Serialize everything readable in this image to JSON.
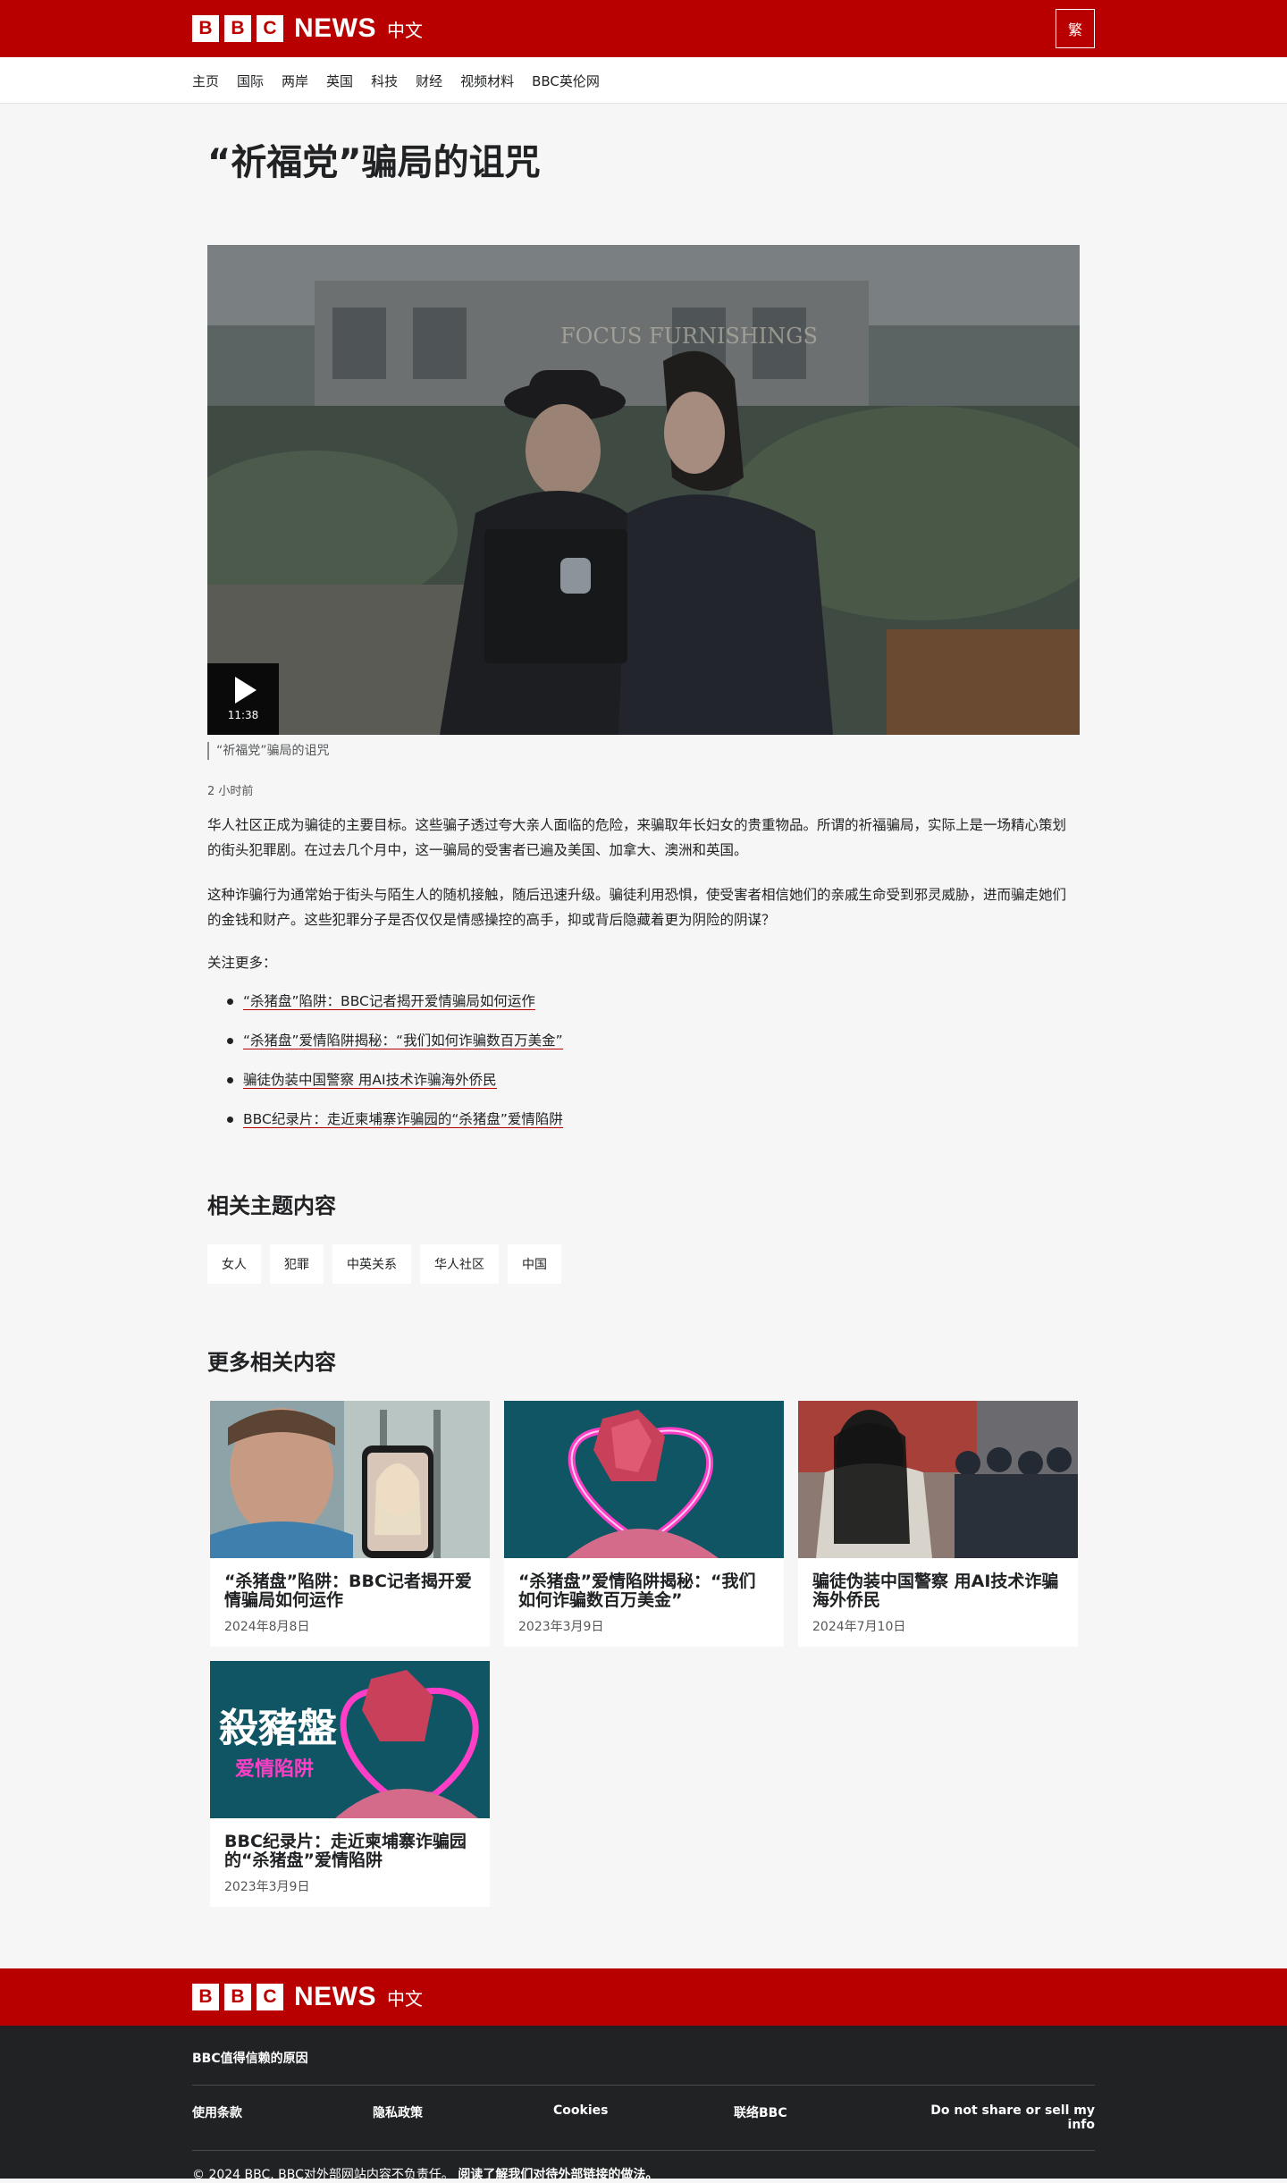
{
  "header": {
    "brand_letters": [
      "B",
      "B",
      "C"
    ],
    "brand_news": "NEWS",
    "brand_lang": "中文",
    "lang_toggle": "繁"
  },
  "nav": {
    "items": [
      "主页",
      "国际",
      "两岸",
      "英国",
      "科技",
      "财经",
      "视频材料",
      "BBC英伦网"
    ]
  },
  "article": {
    "title": "“祈福党”骗局的诅咒",
    "video": {
      "duration": "11:38",
      "caption": "“祈福党”骗局的诅咒",
      "scene_text": "FOCUS FURNISHINGS"
    },
    "timestamp": "2 小时前",
    "paragraphs": [
      "华人社区正成为骗徒的主要目标。这些骗子透过夸大亲人面临的危险，来骗取年长妇女的贵重物品。所谓的祈福骗局，实际上是一场精心策划的街头犯罪剧。在过去几个月中，这一骗局的受害者已遍及美国、加拿大、澳洲和英国。",
      "这种诈骗行为通常始于街头与陌生人的随机接触，随后迅速升级。骗徒利用恐惧，使受害者相信她们的亲戚生命受到邪灵威胁，进而骗走她们的金钱和财产。这些犯罪分子是否仅仅是情感操控的高手，抑或背后隐藏着更为阴险的阴谋？"
    ],
    "more_label": "关注更多：",
    "links": [
      "“杀猪盘”陷阱：BBC记者揭开爱情骗局如何运作",
      "“杀猪盘”爱情陷阱揭秘：“我们如何诈骗数百万美金”",
      "骗徒伪装中国警察 用AI技术诈骗海外侨民",
      "BBC纪录片：走近柬埔寨诈骗园的“杀猪盘”爱情陷阱"
    ]
  },
  "topics": {
    "title": "相关主题内容",
    "items": [
      "女人",
      "犯罪",
      "中英关系",
      "华人社区",
      "中国"
    ]
  },
  "related": {
    "title": "更多相关内容",
    "cards": [
      {
        "title": "“杀猪盘”陷阱：BBC记者揭开爱情骗局如何运作",
        "date": "2024年8月8日"
      },
      {
        "title": "“杀猪盘”爱情陷阱揭秘：“我们如何诈骗数百万美金”",
        "date": "2023年3月9日"
      },
      {
        "title": "骗徒伪装中国警察 用AI技术诈骗海外侨民",
        "date": "2024年7月10日"
      },
      {
        "title": "BBC纪录片：走近柬埔寨诈骗园的“杀猪盘”爱情陷阱",
        "date": "2023年3月9日",
        "thumb_text_1": "殺豬盤",
        "thumb_text_2": "爱情陷阱"
      }
    ]
  },
  "footer": {
    "trust": "BBC值得信赖的原因",
    "links": [
      "使用条款",
      "隐私政策",
      "Cookies",
      "联络BBC",
      "Do not share or sell my info"
    ],
    "copyright": "© 2024 BBC. BBC对外部网站内容不负责任。",
    "external_link": "阅读了解我们对待外部链接的做法。"
  },
  "colors": {
    "brand_red": "#b80000",
    "footer_dark": "#202224",
    "page_bg": "#f6f6f6"
  }
}
